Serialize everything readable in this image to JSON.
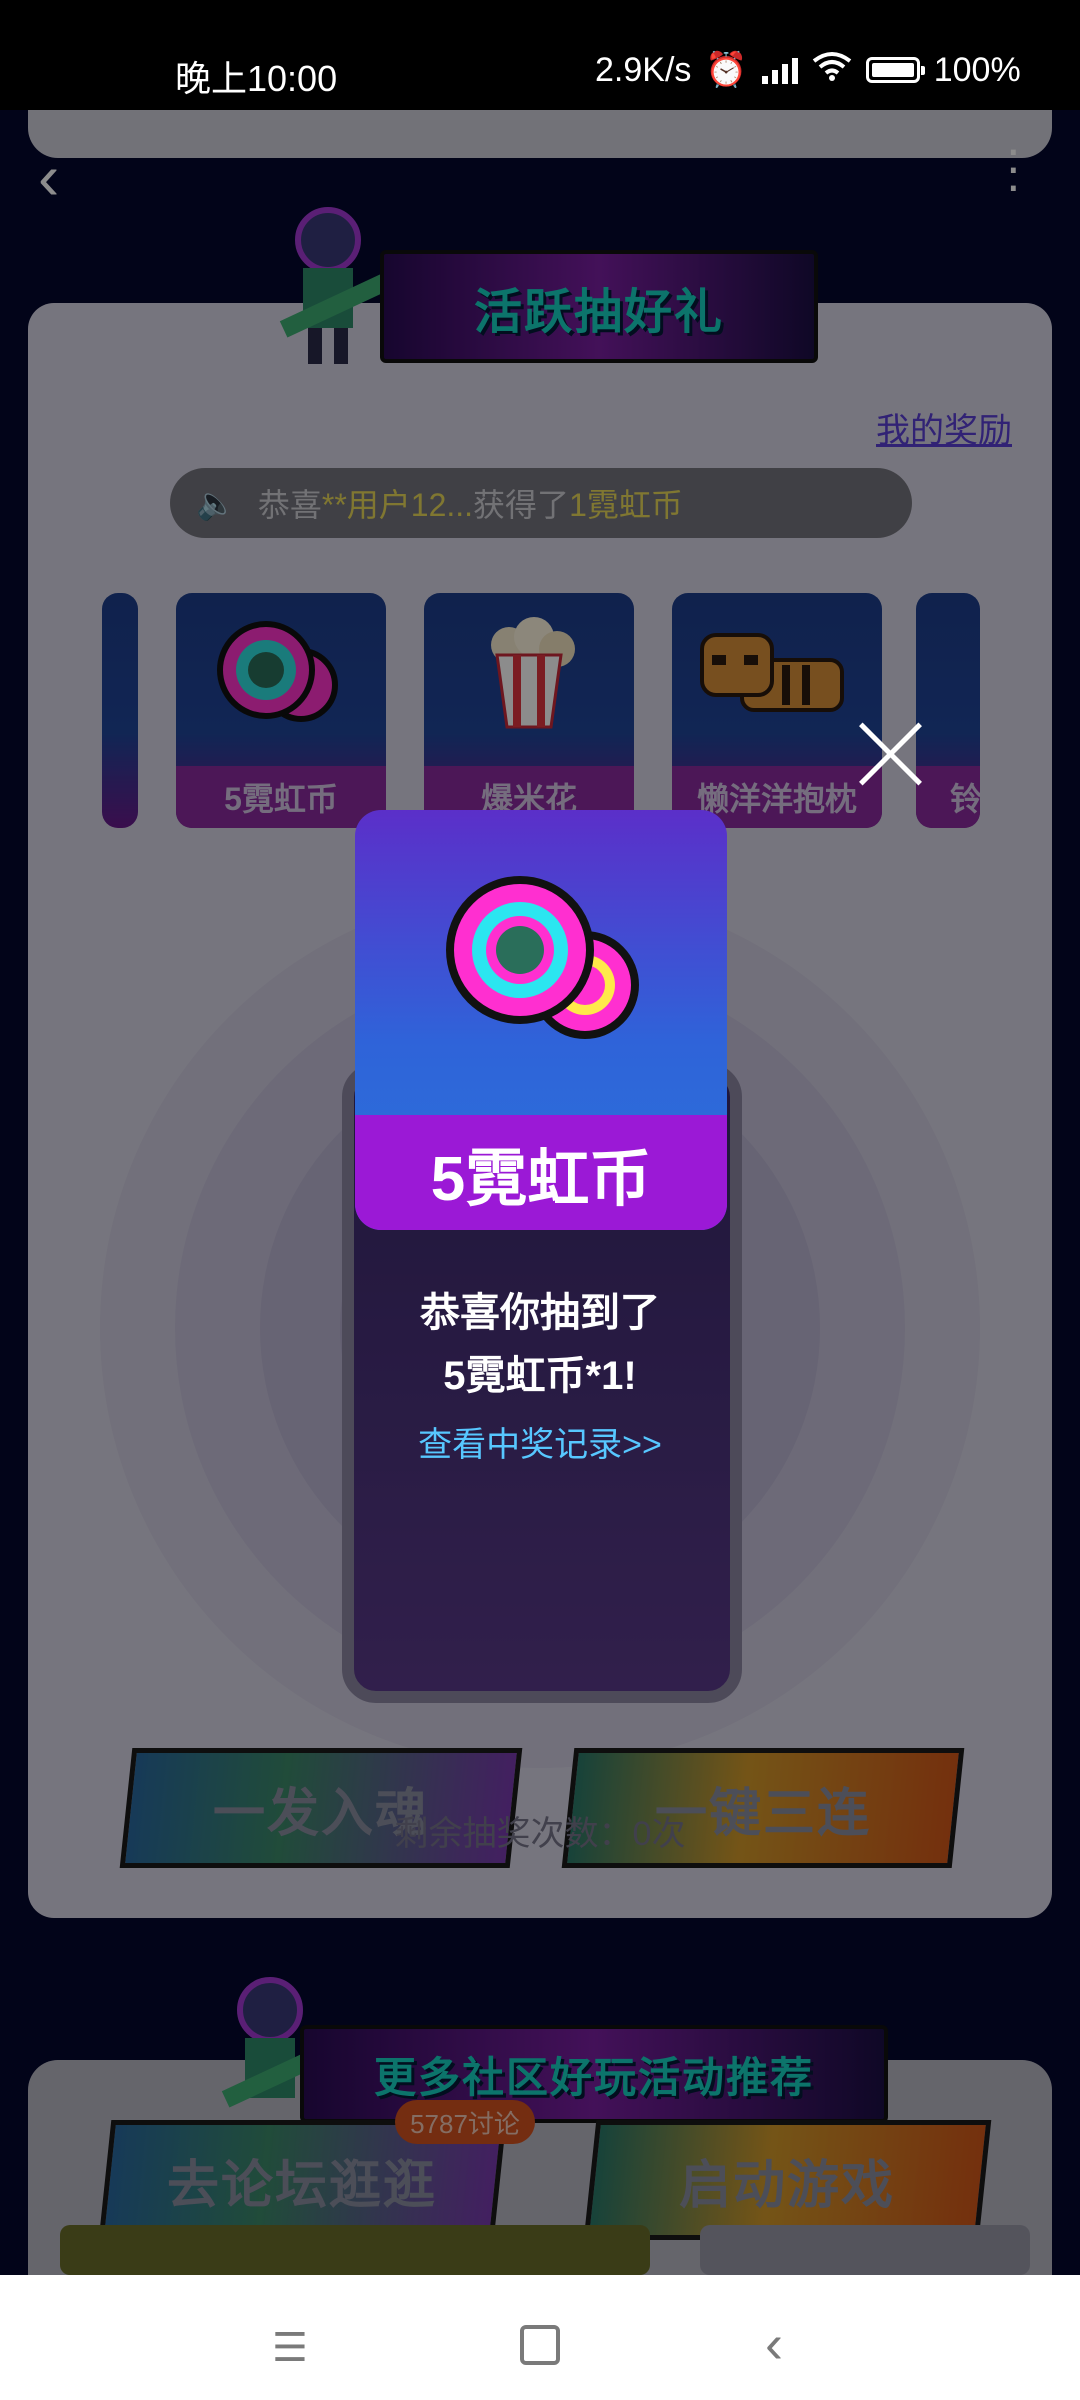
{
  "status_bar": {
    "time": "晚上10:00",
    "net_speed": "2.9K/s",
    "battery": "100%"
  },
  "header": {
    "back_icon": "chevron-left-icon",
    "more_icon": "more-vertical-icon"
  },
  "banner_title": "活跃抽好礼",
  "my_rewards": "我的奖励",
  "marquee": {
    "prefix": "恭喜",
    "user": "**用户12...",
    "middle": "获得了",
    "prize": "1霓虹币"
  },
  "prizes": [
    {
      "label": "5霓虹币"
    },
    {
      "label": "爆米花"
    },
    {
      "label": "懒洋洋抱枕"
    },
    {
      "label": "铃"
    }
  ],
  "buttons": {
    "single": "一发入魂",
    "triple": "一键三连"
  },
  "remaining_draws": "剩余抽奖次数：0次",
  "community": {
    "title": "更多社区好玩活动推荐",
    "forum_button": "去论坛逛逛",
    "forum_badge": "5787讨论",
    "game_button": "启动游戏"
  },
  "popup": {
    "prize_label": "5霓虹币",
    "line1": "恭喜你抽到了",
    "line2": "5霓虹币*1!",
    "record_link": "查看中奖记录>>"
  },
  "colors": {
    "page_bg": "#05082e",
    "panel_bg": "#d8d6e5",
    "popup_label": "#9b19d6",
    "link": "#57c7ff",
    "highlight": "#e9d95a"
  }
}
